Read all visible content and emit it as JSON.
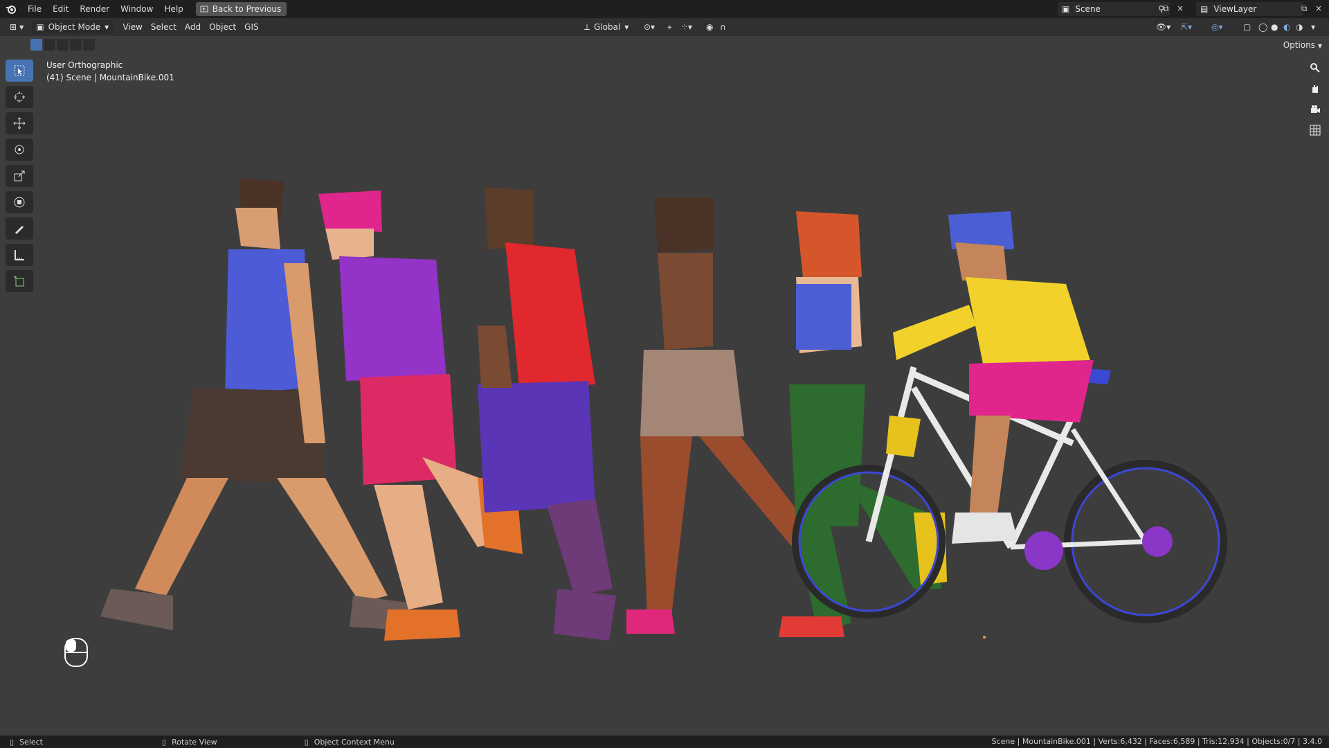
{
  "menu": {
    "file": "File",
    "edit": "Edit",
    "render": "Render",
    "window": "Window",
    "help": "Help",
    "back": "Back to Previous"
  },
  "scene_field": "Scene",
  "view_layer_field": "ViewLayer",
  "header": {
    "mode": "Object Mode",
    "view": "View",
    "select": "Select",
    "add": "Add",
    "object": "Object",
    "gis": "GIS",
    "orientation": "Global",
    "options": "Options"
  },
  "overlay": {
    "view_name": "User Orthographic",
    "object_info": "(41) Scene | MountainBike.001"
  },
  "status": {
    "select": "Select",
    "rotate": "Rotate View",
    "context": "Object Context Menu",
    "stats": "Scene | MountainBike.001 | Verts:6,432 | Faces:6,589 | Tris:12,934 | Objects:0/7 | 3.4.0"
  },
  "colors": {
    "accent": "#4772b3",
    "background": "#3d3d3d"
  }
}
